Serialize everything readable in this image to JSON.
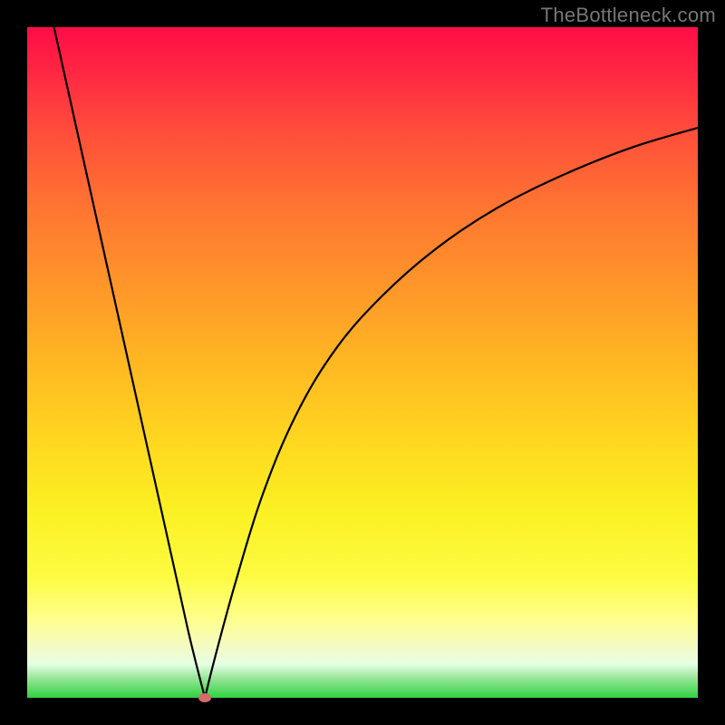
{
  "watermark": "TheBottleneck.com",
  "chart_data": {
    "type": "line",
    "title": "",
    "xlabel": "",
    "ylabel": "",
    "xlim": [
      0,
      100
    ],
    "ylim": [
      0,
      100
    ],
    "grid": false,
    "legend": false,
    "annotations": [],
    "series": [
      {
        "name": "left-branch",
        "x": [
          4,
          8,
          12,
          16,
          20,
          24,
          26.5
        ],
        "y": [
          100,
          82,
          64,
          46,
          28,
          10,
          0
        ]
      },
      {
        "name": "right-branch",
        "x": [
          26.5,
          28,
          31,
          35,
          40,
          46,
          53,
          61,
          70,
          80,
          90,
          100
        ],
        "y": [
          0,
          6,
          17,
          30,
          42,
          52,
          60,
          67,
          73,
          78,
          82,
          85
        ]
      }
    ],
    "marker": {
      "x": 26.5,
      "y": 0,
      "color": "#d46a6a"
    },
    "gradient_stops": [
      {
        "pos": 0,
        "color": "#ff0d46"
      },
      {
        "pos": 16,
        "color": "#ff4f3a"
      },
      {
        "pos": 39,
        "color": "#ff9729"
      },
      {
        "pos": 62,
        "color": "#ffd81f"
      },
      {
        "pos": 82,
        "color": "#fdfb42"
      },
      {
        "pos": 95,
        "color": "#e5ffe5"
      },
      {
        "pos": 100,
        "color": "#2fd240"
      }
    ]
  }
}
